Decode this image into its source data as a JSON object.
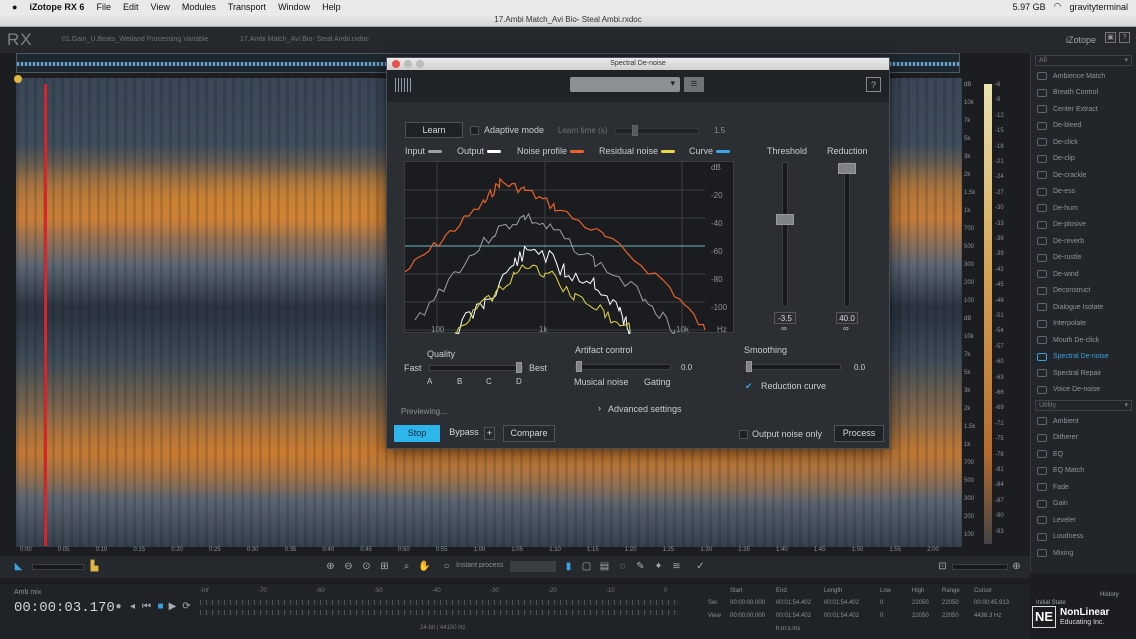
{
  "menubar": {
    "app": "iZotope RX 6",
    "items": [
      "File",
      "Edit",
      "View",
      "Modules",
      "Transport",
      "Window",
      "Help"
    ],
    "storage": "5.97 GB",
    "user": "gravityterminal"
  },
  "window": {
    "title": "17.Ambi Match_Avi Bio- Steal Ambi.rxdoc"
  },
  "app": {
    "logo": "RX",
    "brand": "iZotope"
  },
  "file_tabs": [
    "01.Gain_U.Beats_Wetland Processing Variable",
    "17.Ambi Match_Avi Bio- Steal Ambi.rxdoc"
  ],
  "time_ticks": [
    "0:00",
    "0:05",
    "0:10",
    "0:15",
    "0:20",
    "0:25",
    "0:30",
    "0:35",
    "0:40",
    "0:45",
    "0:50",
    "0:55",
    "1:00",
    "1:05",
    "1:10",
    "1:15",
    "1:20",
    "1:25",
    "1:30",
    "1:35",
    "1:40",
    "1:45",
    "1:50",
    "1:55",
    "2:00"
  ],
  "db_ticks_left": [
    "dB",
    "10k",
    "7k",
    "5k",
    "3k",
    "2k",
    "1.5k",
    "1k",
    "700",
    "500",
    "300",
    "200",
    "100",
    "dB",
    "10k",
    "7k",
    "5k",
    "3k",
    "2k",
    "1.5k",
    "1k",
    "700",
    "500",
    "300",
    "200",
    "100"
  ],
  "db_ticks_right": [
    "-6",
    "-9",
    "-12",
    "-15",
    "-18",
    "-21",
    "-24",
    "-27",
    "-30",
    "-33",
    "-36",
    "-39",
    "-42",
    "-45",
    "-48",
    "-51",
    "-54",
    "-57",
    "-60",
    "-63",
    "-66",
    "-69",
    "-72",
    "-75",
    "-78",
    "-81",
    "-84",
    "-87",
    "-90",
    "-93"
  ],
  "sidebar": {
    "dropdown_top": "All",
    "items": [
      "Ambience Match",
      "Breath Control",
      "Center Extract",
      "De-bleed",
      "De-click",
      "De-clip",
      "De-crackle",
      "De-ess",
      "De-hum",
      "De-plosive",
      "De-reverb",
      "De-rustle",
      "De-wind",
      "Deconstruct",
      "Dialogue Isolate",
      "Interpolate",
      "Mouth De-click",
      "Spectral De-noise",
      "Spectral Repair",
      "Voice De-noise"
    ],
    "active": "Spectral De-noise",
    "dropdown_util": "Utility",
    "util_items": [
      "Ambient",
      "Ditherer",
      "EQ",
      "EQ Match",
      "Fade",
      "Gain",
      "Leveler",
      "Loudness",
      "Mixing"
    ]
  },
  "dialog": {
    "title": "Spectral De-noise",
    "learn": "Learn",
    "adaptive": "Adaptive mode",
    "learn_time_label": "Learn time (s)",
    "learn_time": "1.5",
    "legend": [
      {
        "name": "Input",
        "color": "#9aa0a6"
      },
      {
        "name": "Output",
        "color": "#ffffff"
      },
      {
        "name": "Noise profile",
        "color": "#e8622a"
      },
      {
        "name": "Residual noise",
        "color": "#e6d84a"
      },
      {
        "name": "Curve",
        "color": "#39a9e6"
      }
    ],
    "graph_y": [
      "dB",
      "-20",
      "-40",
      "-60",
      "-80",
      "-100"
    ],
    "graph_x": [
      "100",
      "1k",
      "10k",
      "Hz"
    ],
    "threshold_label": "Threshold",
    "reduction_label": "Reduction",
    "threshold": "-3.5",
    "reduction": "40.0",
    "threshold_level": 0.62,
    "reduction_level": 1.0,
    "quality_label": "Quality",
    "fast": "Fast",
    "best": "Best",
    "quality_marks": [
      "A",
      "B",
      "C",
      "D"
    ],
    "artifact_label": "Artifact control",
    "artifact": "0.0",
    "musical": "Musical noise",
    "gating": "Gating",
    "smoothing_label": "Smoothing",
    "smoothing": "0.0",
    "reduction_curve": "Reduction curve",
    "previewing": "Previewing...",
    "advanced": "Advanced settings",
    "stop": "Stop",
    "bypass": "Bypass",
    "plus": "+",
    "compare": "Compare",
    "output_only": "Output noise only",
    "process": "Process"
  },
  "toolbar": {
    "instant": "Instant process"
  },
  "transport": {
    "label": "Amb mix",
    "time": "00:00:03.170",
    "format": "24-bit | 44100 Hz",
    "info_headers": [
      "Start",
      "End",
      "Length",
      "Low",
      "High",
      "Range",
      "Cursor"
    ],
    "sel_label": "Sel",
    "view_label": "View",
    "sel": [
      "00:00:00.000",
      "00:01:54.402",
      "00:01:54.402",
      "0",
      "22050",
      "22050",
      "00:00:45.913"
    ],
    "view": [
      "00:00:00.000",
      "00:01:54.402",
      "00:01:54.402",
      "0",
      "22050",
      "22050",
      "4436.3 Hz"
    ],
    "time_units": "h:m:s.ms",
    "meter_ticks": [
      "-Inf",
      "-70",
      "-60",
      "-50",
      "-40",
      "-30",
      "-20",
      "-10",
      "0"
    ]
  },
  "branding": {
    "letters": "NE",
    "line1": "NonLinear",
    "line2": "Educating Inc.",
    "small": "Initial State",
    "history": "History"
  }
}
